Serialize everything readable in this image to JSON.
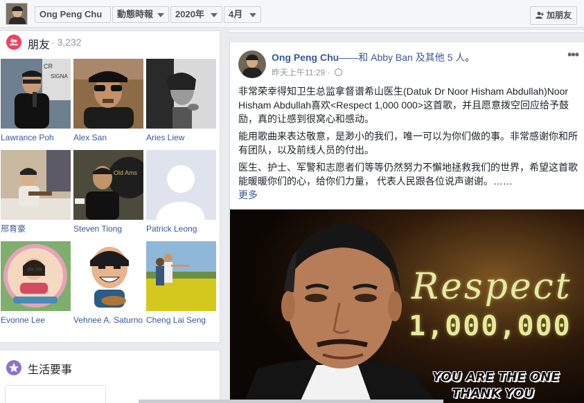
{
  "topbar": {
    "name_label": "Ong Peng Chu",
    "feed_select": "動態時報",
    "year_select": "2020年",
    "month_select": "4月",
    "add_friend_label": "加朋友",
    "add_friend_icon": "add-person-icon"
  },
  "friends": {
    "title": "朋友",
    "count": "· 3,232",
    "icon": "friends-icon",
    "accent": "#f3425f",
    "items": [
      {
        "name": "Lawrance Poh"
      },
      {
        "name": "Alex San"
      },
      {
        "name": "Aries Liew"
      },
      {
        "name": "邢育豪"
      },
      {
        "name": "Steven Tiong"
      },
      {
        "name": "Patrick Leong"
      },
      {
        "name": "Evonne Lee"
      },
      {
        "name": "Vehnee A. Saturno"
      },
      {
        "name": "Cheng Lai Seng"
      }
    ]
  },
  "life_events": {
    "title": "生活要事",
    "icon": "star-icon",
    "accent": "#8c72cb"
  },
  "post": {
    "author": "Ong Peng Chu",
    "with_text": "——和",
    "tagged": "Abby Ban",
    "others": "及其他 5 人",
    "period": "。",
    "time": "昨天上午11:29",
    "time_sep": " · ",
    "more_icon": "more-options-icon",
    "para1": "非常荣幸得知卫生总监拿督谱希山医生(Datuk Dr Noor Hisham Abdullah)Noor Hisham Abdullah喜欢<Respect 1,000 000>这首歌，并且愿意拨空回应给予鼓励，真的让感到很窝心和感动。",
    "para2": "能用歌曲来表达敬意，是渺小的我们，唯一可以为你们做的事。非常感谢你和所有团队，以及前线人员的付出。",
    "para3": "医生、护士、军警和志愿者们等等仍然努力不懈地拯救我们的世界，希望这首歌能暖暖你们的心，给你们力量， 代表人民跟各位说声谢谢。……",
    "see_more": "更多",
    "image": {
      "line1": "Respect",
      "line2": "1,000,000",
      "line3": "YOU ARE THE ONE",
      "line4": "THANK YOU"
    },
    "link_color": "#365899"
  }
}
